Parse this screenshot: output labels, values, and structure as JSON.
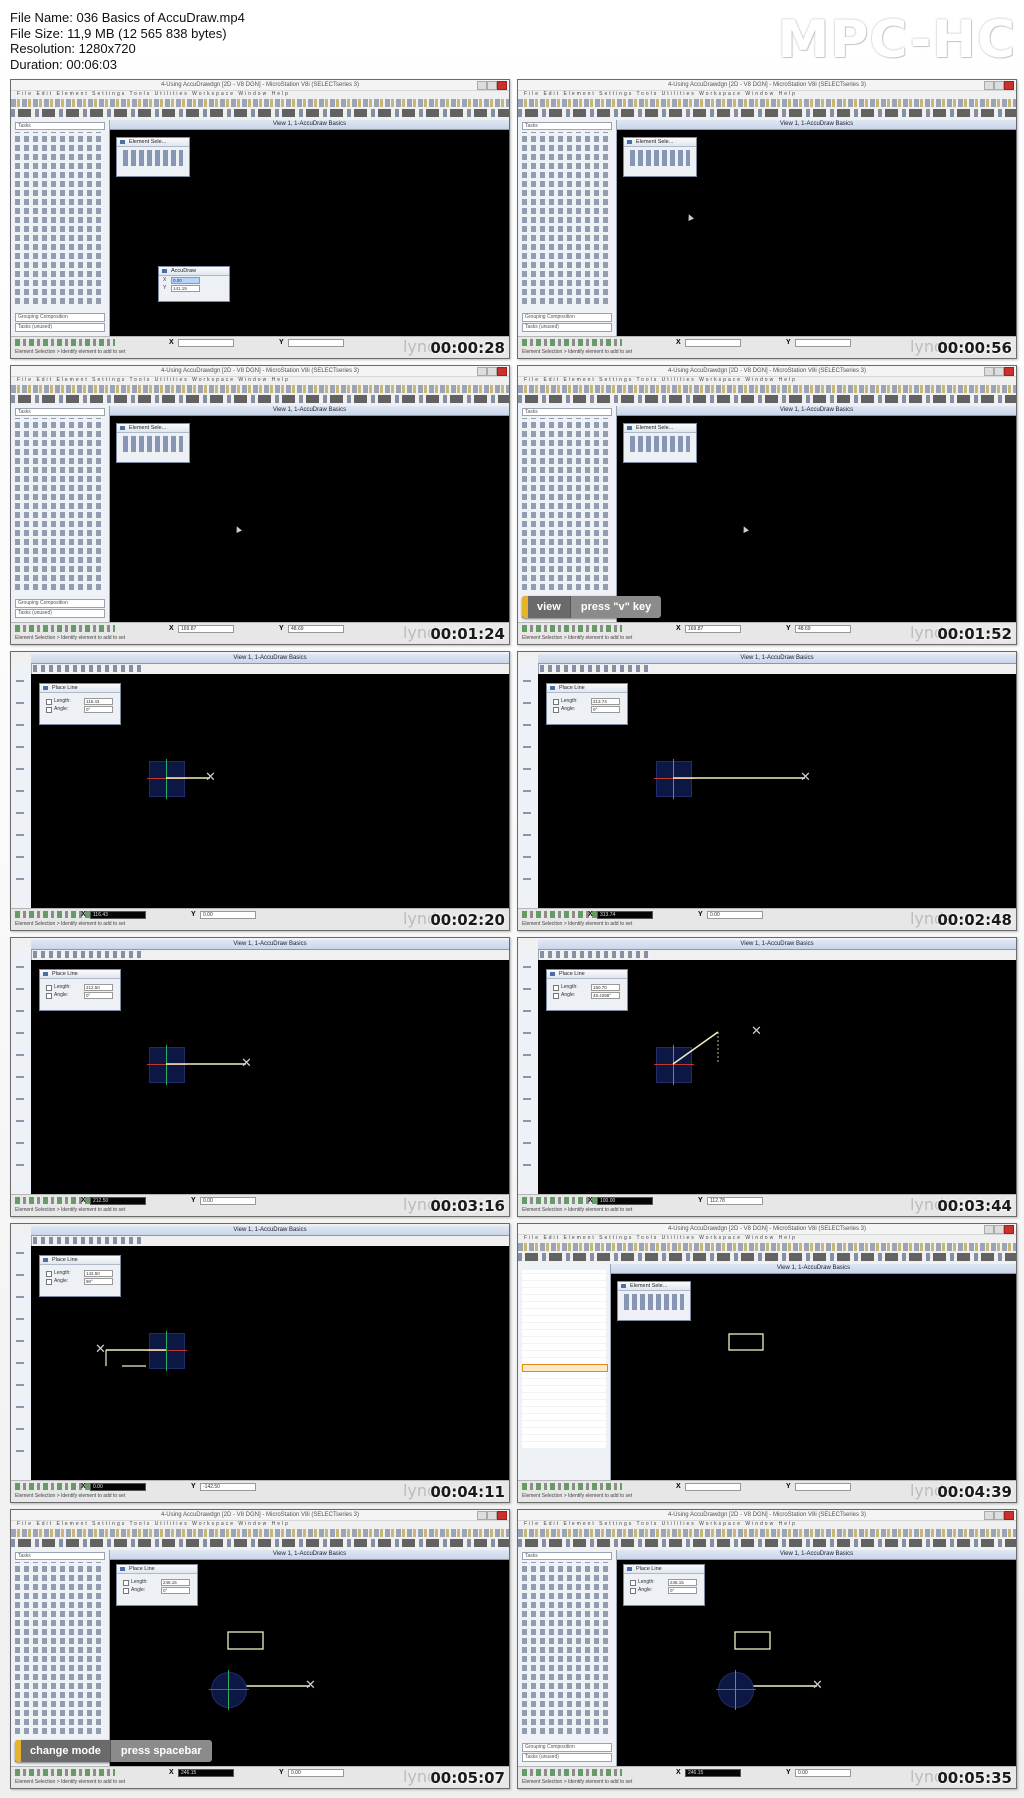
{
  "header": {
    "file_name_line": "File Name: 036 Basics of AccuDraw.mp4",
    "file_size_line": "File Size: 11,9 MB (12 565 838 bytes)",
    "resolution_line": "Resolution: 1280x720",
    "duration_line": "Duration: 00:06:03",
    "logo": "MPC-HC"
  },
  "app": {
    "window_title": "4-Using AccuDrawdgn [2D - V8 DGN] - MicroStation V8i (SELECTseries 3)",
    "menu": "File  Edit  Element  Settings  Tools  Utilities  Workspace  Window  Help",
    "view_title": "View 1, 1-AccuDraw Basics",
    "element_selection_dialog": "Element Sele...",
    "accudraw_dialog": "AccuDraw",
    "place_line_dialog": "Place Line",
    "length_label": "Length:",
    "angle_label": "Angle:",
    "tasks_dropdown": "Tasks",
    "drawing_label": "Drawing",
    "groups_dropdown": "Grouping Composition",
    "level_dropdown": "Tasks (unused)",
    "status_hint": "Element Selection > Identify element to add to set",
    "x_label": "X",
    "y_label": "Y",
    "watermark": "lynda"
  },
  "frames": [
    {
      "timestamp": "00:00:28",
      "kind": "accudraw-float",
      "ax": "0.00",
      "ay": "141.19"
    },
    {
      "timestamp": "00:00:56",
      "kind": "select",
      "x": "",
      "y": ""
    },
    {
      "timestamp": "00:01:24",
      "kind": "select",
      "x": "169.87",
      "y": "48.69"
    },
    {
      "timestamp": "00:01:52",
      "kind": "select",
      "x": "169.87",
      "y": "48.69",
      "key_action": "view",
      "key_hint": "press \"v\" key"
    },
    {
      "timestamp": "00:02:20",
      "kind": "placeline",
      "length": "116.43",
      "angle": "0°",
      "x": "116.43",
      "y": "0.00"
    },
    {
      "timestamp": "00:02:48",
      "kind": "placeline",
      "length": "313.74",
      "angle": "0°",
      "x": "313.74",
      "y": "0.00"
    },
    {
      "timestamp": "00:03:16",
      "kind": "placeline",
      "length": "212.50",
      "angle": "0°",
      "x": "212.50",
      "y": "0.00"
    },
    {
      "timestamp": "00:03:44",
      "kind": "placeline",
      "length": "150.70",
      "angle": "48.4298°",
      "x": "100.00",
      "y": "112.78"
    },
    {
      "timestamp": "00:04:11",
      "kind": "placeline",
      "length": "142.50",
      "angle": "90°",
      "x": "0.00",
      "y": "-142.50"
    },
    {
      "timestamp": "00:04:39",
      "kind": "properties",
      "x": "",
      "y": ""
    },
    {
      "timestamp": "00:05:07",
      "kind": "placeline-rect",
      "length": "246.15",
      "angle": "0°",
      "x": "246.15",
      "y": "0.00",
      "key_action": "change mode",
      "key_hint": "press spacebar"
    },
    {
      "timestamp": "00:05:35",
      "kind": "placeline-rect",
      "length": "246.15",
      "angle": "0°",
      "x": "246.15",
      "y": "0.00"
    }
  ],
  "colors": {
    "view_bg": "#000000",
    "accent_key": "#e6b32a",
    "compass_bg": "#0d1744"
  }
}
